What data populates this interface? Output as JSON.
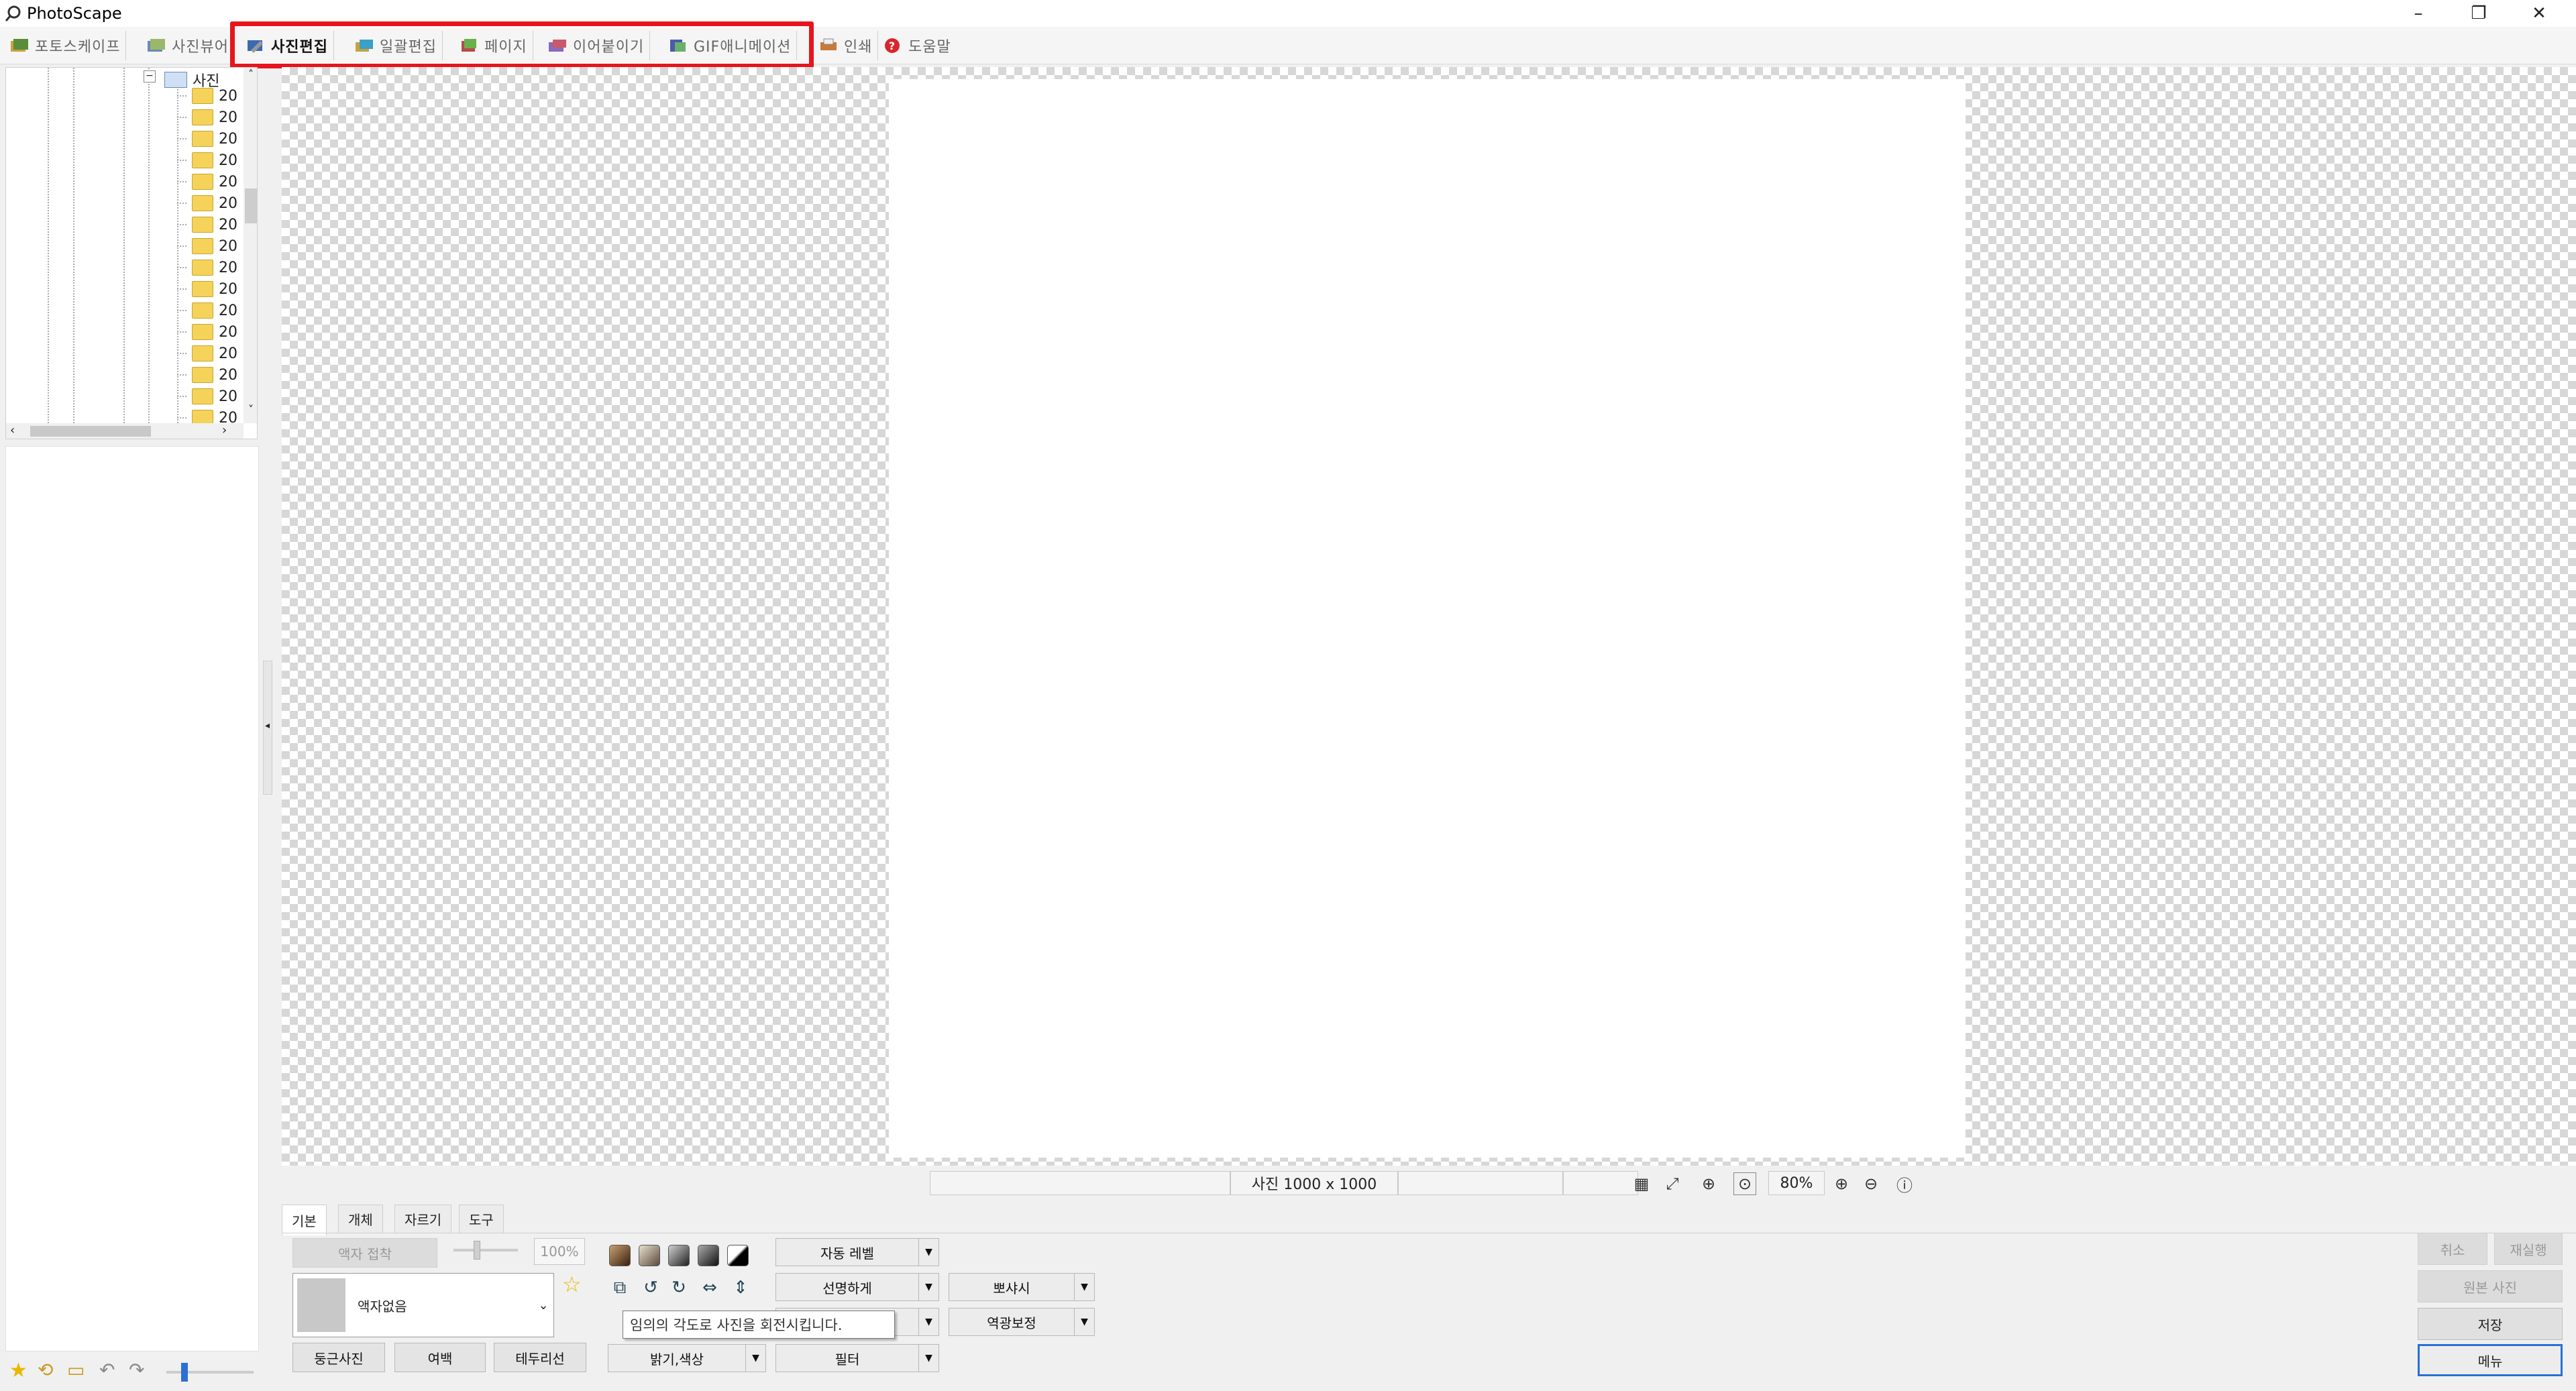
{
  "window": {
    "title": "PhotoScape",
    "minimize": "–",
    "restore": "❐",
    "close": "✕"
  },
  "tabs": [
    {
      "label": "포토스케이프",
      "icon": "photoscape-icon"
    },
    {
      "label": "사진뷰어",
      "icon": "viewer-icon"
    },
    {
      "label": "사진편집",
      "icon": "editor-icon",
      "active": true
    },
    {
      "label": "일괄편집",
      "icon": "batch-icon"
    },
    {
      "label": "페이지",
      "icon": "page-icon"
    },
    {
      "label": "이어붙이기",
      "icon": "combine-icon"
    },
    {
      "label": "GIF애니메이션",
      "icon": "gif-icon"
    },
    {
      "label": "인쇄",
      "icon": "print-icon"
    },
    {
      "label": "도움말",
      "icon": "help-icon"
    }
  ],
  "tree": {
    "root": "사진",
    "items": [
      "20",
      "20",
      "20",
      "20",
      "20",
      "20",
      "20",
      "20",
      "20",
      "20",
      "20",
      "20",
      "20",
      "20",
      "20",
      "20"
    ]
  },
  "status": {
    "photo_size": "사진 1000 x 1000",
    "zoom": "80%"
  },
  "panel": {
    "tabs": [
      "기본",
      "개체",
      "자르기",
      "도구"
    ],
    "frame_fit": "액자 접착",
    "percent": "100%",
    "frame_select": "액자없음",
    "round_photo": "둥근사진",
    "margin": "여백",
    "border": "테두리선",
    "auto_level": "자동 레벨",
    "sharpen": "선명하게",
    "brightness": "밝기,색상",
    "filter": "필터",
    "soft": "뽀샤시",
    "backlight": "역광보정",
    "tooltip": "임의의 각도로 사진을 회전시킵니다."
  },
  "right_buttons": {
    "undo": "취소",
    "redo": "재실행",
    "original": "원본 사진",
    "save": "저장",
    "menu": "메뉴"
  },
  "colors": {
    "highlight": "#e8141c",
    "menu_border": "#2a6fd6"
  }
}
